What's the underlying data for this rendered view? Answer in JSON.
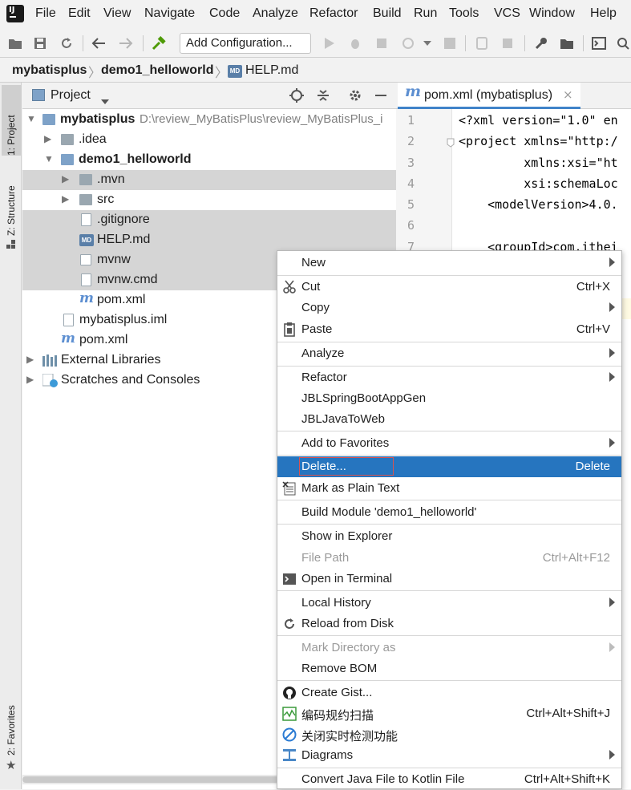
{
  "menubar": {
    "items": [
      "File",
      "Edit",
      "View",
      "Navigate",
      "Code",
      "Analyze",
      "Refactor",
      "Build",
      "Run",
      "Tools",
      "VCS",
      "Window",
      "Help"
    ]
  },
  "toolbar": {
    "config_label": "Add Configuration..."
  },
  "breadcrumb": {
    "items": [
      "mybatisplus",
      "demo1_helloworld",
      "HELP.md"
    ]
  },
  "side_tabs": {
    "project": "1: Project",
    "structure": "Z: Structure",
    "favorites": "2: Favorites"
  },
  "project_panel": {
    "title": "Project",
    "tree": [
      {
        "label": "mybatisplus",
        "path": "D:\\review_MyBatisPlus\\review_MyBatisPlus_i"
      },
      {
        "label": ".idea"
      },
      {
        "label": "demo1_helloworld"
      },
      {
        "label": ".mvn"
      },
      {
        "label": "src"
      },
      {
        "label": ".gitignore"
      },
      {
        "label": "HELP.md"
      },
      {
        "label": "mvnw"
      },
      {
        "label": "mvnw.cmd"
      },
      {
        "label": "pom.xml"
      },
      {
        "label": "mybatisplus.iml"
      },
      {
        "label": "pom.xml"
      },
      {
        "label": "External Libraries"
      },
      {
        "label": "Scratches and Consoles"
      }
    ]
  },
  "editor": {
    "tab_label": "pom.xml (mybatisplus)",
    "line_numbers": [
      "1",
      "2",
      "3",
      "4",
      "5",
      "6",
      "7"
    ],
    "lines": [
      "<?xml version=\"1.0\" en",
      "<project xmlns=\"http:/",
      "         xmlns:xsi=\"ht",
      "         xsi:schemaLoc",
      "    <modelVersion>4.0.",
      "",
      "    <groupId>com.ithei"
    ]
  },
  "context_menu": {
    "items": [
      {
        "label": "New",
        "shortcut": "",
        "submenu": true
      },
      {
        "label": "Cut",
        "shortcut": "Ctrl+X",
        "icon": "scissors-icon"
      },
      {
        "label": "Copy",
        "shortcut": "",
        "submenu": true
      },
      {
        "label": "Paste",
        "shortcut": "Ctrl+V",
        "icon": "clipboard-icon"
      },
      {
        "label": "Analyze",
        "shortcut": "",
        "submenu": true
      },
      {
        "label": "Refactor",
        "shortcut": "",
        "submenu": true
      },
      {
        "label": "JBLSpringBootAppGen",
        "shortcut": ""
      },
      {
        "label": "JBLJavaToWeb",
        "shortcut": ""
      },
      {
        "label": "Add to Favorites",
        "shortcut": "",
        "submenu": true
      },
      {
        "label": "Delete...",
        "shortcut": "Delete",
        "highlighted": true
      },
      {
        "label": "Mark as Plain Text",
        "shortcut": "",
        "icon": "plain-text-icon"
      },
      {
        "label": "Build Module 'demo1_helloworld'",
        "shortcut": ""
      },
      {
        "label": "Show in Explorer",
        "shortcut": ""
      },
      {
        "label": "File Path",
        "shortcut": "Ctrl+Alt+F12",
        "disabled": true
      },
      {
        "label": "Open in Terminal",
        "shortcut": "",
        "icon": "terminal-icon"
      },
      {
        "label": "Local History",
        "shortcut": "",
        "submenu": true
      },
      {
        "label": "Reload from Disk",
        "shortcut": "",
        "icon": "reload-icon"
      },
      {
        "label": "Mark Directory as",
        "shortcut": "",
        "submenu": true,
        "disabled": true
      },
      {
        "label": "Remove BOM",
        "shortcut": ""
      },
      {
        "label": "Create Gist...",
        "shortcut": "",
        "icon": "github-icon"
      },
      {
        "label": "编码规约扫描",
        "shortcut": "Ctrl+Alt+Shift+J",
        "icon": "scan-icon"
      },
      {
        "label": "关闭实时检测功能",
        "shortcut": "",
        "icon": "disable-icon"
      },
      {
        "label": "Diagrams",
        "shortcut": "",
        "submenu": true,
        "icon": "diagram-icon"
      },
      {
        "label": "Convert Java File to Kotlin File",
        "shortcut": "Ctrl+Alt+Shift+K"
      }
    ]
  },
  "colors": {
    "selection": "#2675bf",
    "tree_selection": "#d5d5d5",
    "accent": "#4083c9"
  }
}
